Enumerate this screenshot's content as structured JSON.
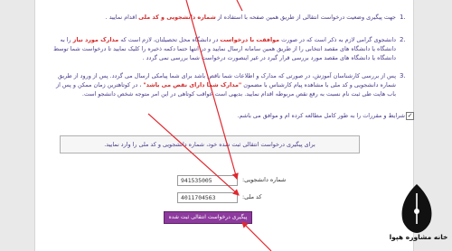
{
  "paragraphs": {
    "p1": {
      "number": "1.",
      "text_pre": "جهت پیگیری وضعیت درخواست انتقالی از طریق همین صفحه با استفاده از ",
      "text_red": "شماره دانشجویی و کد ملی",
      "text_post": " اقدام نمایید ."
    },
    "p2": {
      "number": "2.",
      "text_pre": "دانشجوی گرامی لازم به ذکر است که در صورت ",
      "text_red": "موافقت با درخواست",
      "text_mid": " در دانشگاه محل تحصیلتان، لازم است که ",
      "text_red2": "مدارک مورد نیاز",
      "text_post": " را به دانشگاه یا دانشگاه های مقصد انتخابی را از طریق همین سامانه ارسال نمایید و در انتها حتما دکمه ذخیره را کلیک نمایید تا درخواست شما توسط دانشگاه یا دانشگاه های مقصد مورد بررسی قرار گیرد در غیر اینصورت درخواست شما بررسی نمی گردد ."
    },
    "p3": {
      "number": "3.",
      "text_pre": "پس از بررسی کارشناسان آموزش، در صورتی که مدارک و اطلاعات شما ناقص باشد برای شما پیامکی ارسال می گردد. پس از ورود از طریق شماره دانشجویی و کد ملی با مشاهده پیام کارشناس با مضمون ",
      "text_red": "\"مدارک شما دارای نقص می باشد\"",
      "text_post": " ، در کوتاهترین زمان ممکن و پس از باب هایت طی ثبت نام نسبت به رفع نقص مربوطه اقدام نمایید. بدیهی است عواقب کوتاهی در این امر متوجه شخص دانشجو است."
    }
  },
  "agreement": {
    "label": "شرایط و مقررات را به طور کامل مطالعه کرده ام و موافق می باشم.",
    "checked": "✓"
  },
  "notice": "برای پیگیری درخواست انتقالی ثبت شده خود، شماره دانشجویی و کد ملی را وارد نمایید.",
  "form": {
    "student_number_label": "شماره دانشجویی:",
    "student_number_value": "941535005",
    "national_code_label": "کد ملی:",
    "national_code_value": "4011704563",
    "submit_label": "پیگیری درخواست انتقالی ثبت شده"
  },
  "logo": {
    "text": "خانه مشاوره هپوا",
    "icon": "pen-nib-icon"
  },
  "colors": {
    "text": "#4b3b8a",
    "highlight": "#d42a2a",
    "button": "#8d3a9e",
    "arrow": "#e0282f"
  }
}
